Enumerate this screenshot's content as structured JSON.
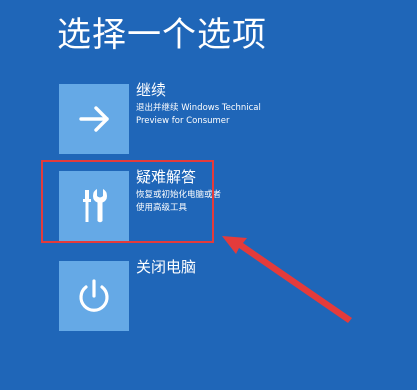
{
  "title": "选择一个选项",
  "options": [
    {
      "title": "继续",
      "description": "退出并继续 Windows Technical Preview for Consumer",
      "icon": "arrow-right-icon"
    },
    {
      "title": "疑难解答",
      "description": "恢复或初始化电脑或者使用高级工具",
      "icon": "tools-icon"
    },
    {
      "title": "关闭电脑",
      "icon": "power-icon"
    }
  ],
  "colors": {
    "background": "#1f66b8",
    "tile": "#65a9e6",
    "annotation": "#e43b3b"
  }
}
